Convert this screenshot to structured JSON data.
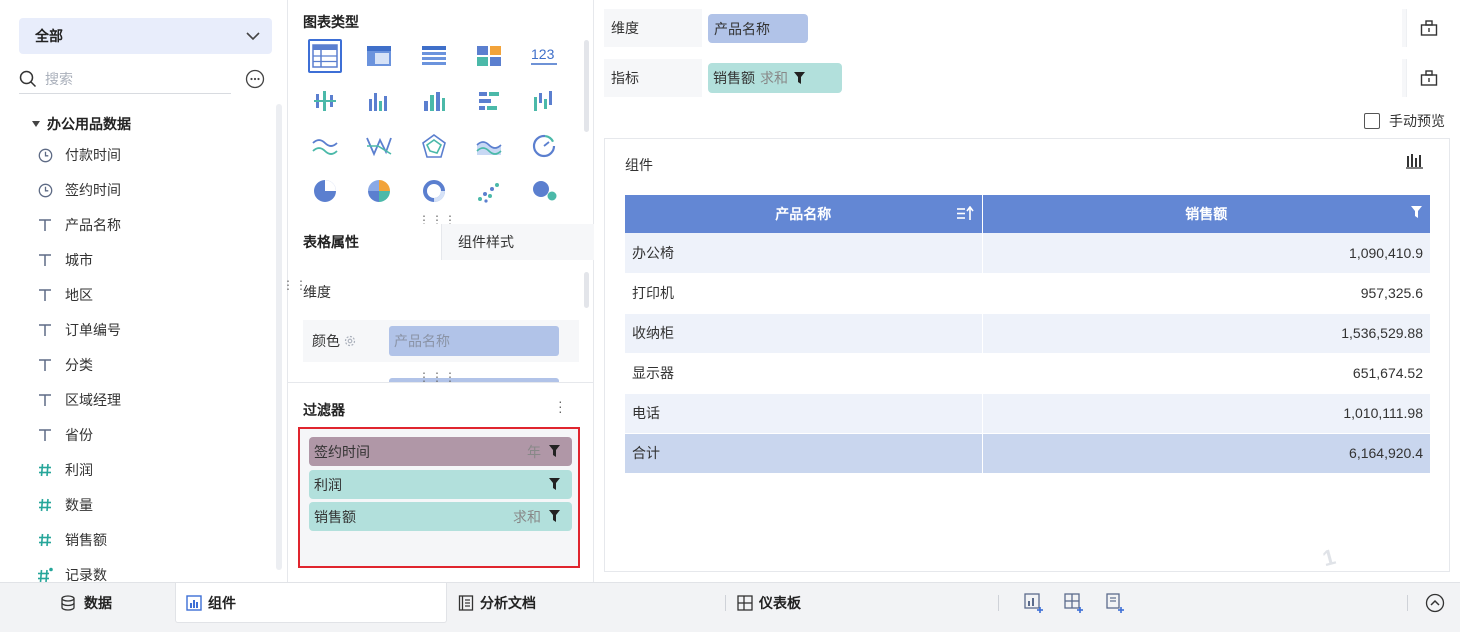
{
  "left_panel": {
    "scope_select": "全部",
    "search_placeholder": "搜索",
    "dataset_title": "办公用品数据",
    "fields": [
      {
        "name": "付款时间",
        "type": "date",
        "icon": "clock-icon"
      },
      {
        "name": "签约时间",
        "type": "date",
        "icon": "clock-icon"
      },
      {
        "name": "产品名称",
        "type": "text",
        "icon": "text-t-icon"
      },
      {
        "name": "城市",
        "type": "text",
        "icon": "text-t-icon"
      },
      {
        "name": "地区",
        "type": "text",
        "icon": "text-t-icon"
      },
      {
        "name": "订单编号",
        "type": "text",
        "icon": "text-t-icon"
      },
      {
        "name": "分类",
        "type": "text",
        "icon": "text-t-icon"
      },
      {
        "name": "区域经理",
        "type": "text",
        "icon": "text-t-icon"
      },
      {
        "name": "省份",
        "type": "text",
        "icon": "text-t-icon"
      },
      {
        "name": "利润",
        "type": "number",
        "icon": "hash-icon"
      },
      {
        "name": "数量",
        "type": "number",
        "icon": "hash-icon"
      },
      {
        "name": "销售额",
        "type": "number",
        "icon": "hash-icon"
      },
      {
        "name": "记录数",
        "type": "number",
        "icon": "hash-star-icon"
      }
    ]
  },
  "middle_panel": {
    "chart_types_title": "图表类型",
    "tabs": {
      "table_props": "表格属性",
      "component_style": "组件样式"
    },
    "dimension_label": "维度",
    "color_label": "颜色",
    "color_field": "产品名称",
    "filter_title": "过滤器",
    "filters": [
      {
        "name": "签约时间",
        "agg": "年",
        "color": "#b097a7"
      },
      {
        "name": "利润",
        "agg": "",
        "color": "#b2e0dc"
      },
      {
        "name": "销售额",
        "agg": "求和",
        "color": "#b2e0dc"
      }
    ]
  },
  "right_panel": {
    "dimension_shelf": {
      "label": "维度",
      "pill": "产品名称"
    },
    "measure_shelf": {
      "label": "指标",
      "pill": "销售额",
      "agg": "求和"
    },
    "manual_preview": "手动预览",
    "widget_title": "组件",
    "table": {
      "headers": [
        "产品名称",
        "销售额"
      ],
      "rows": [
        [
          "办公椅",
          "1,090,410.9"
        ],
        [
          "打印机",
          "957,325.6"
        ],
        [
          "收纳柜",
          "1,536,529.88"
        ],
        [
          "显示器",
          "651,674.52"
        ],
        [
          "电话",
          "1,010,111.98"
        ]
      ],
      "total": [
        "合计",
        "6,164,920.4"
      ]
    },
    "watermark": "1"
  },
  "bottom_bar": {
    "tabs": [
      "数据",
      "组件",
      "分析文档",
      "仪表板"
    ],
    "active_tab": "组件"
  },
  "colors": {
    "accent": "#3d6fd6",
    "table_header": "#6387d4",
    "dimension_pill": "#b1c3e8",
    "measure_pill": "#b2e0dc",
    "date_filter_pill": "#b097a7",
    "highlight_border": "#e0252e"
  }
}
